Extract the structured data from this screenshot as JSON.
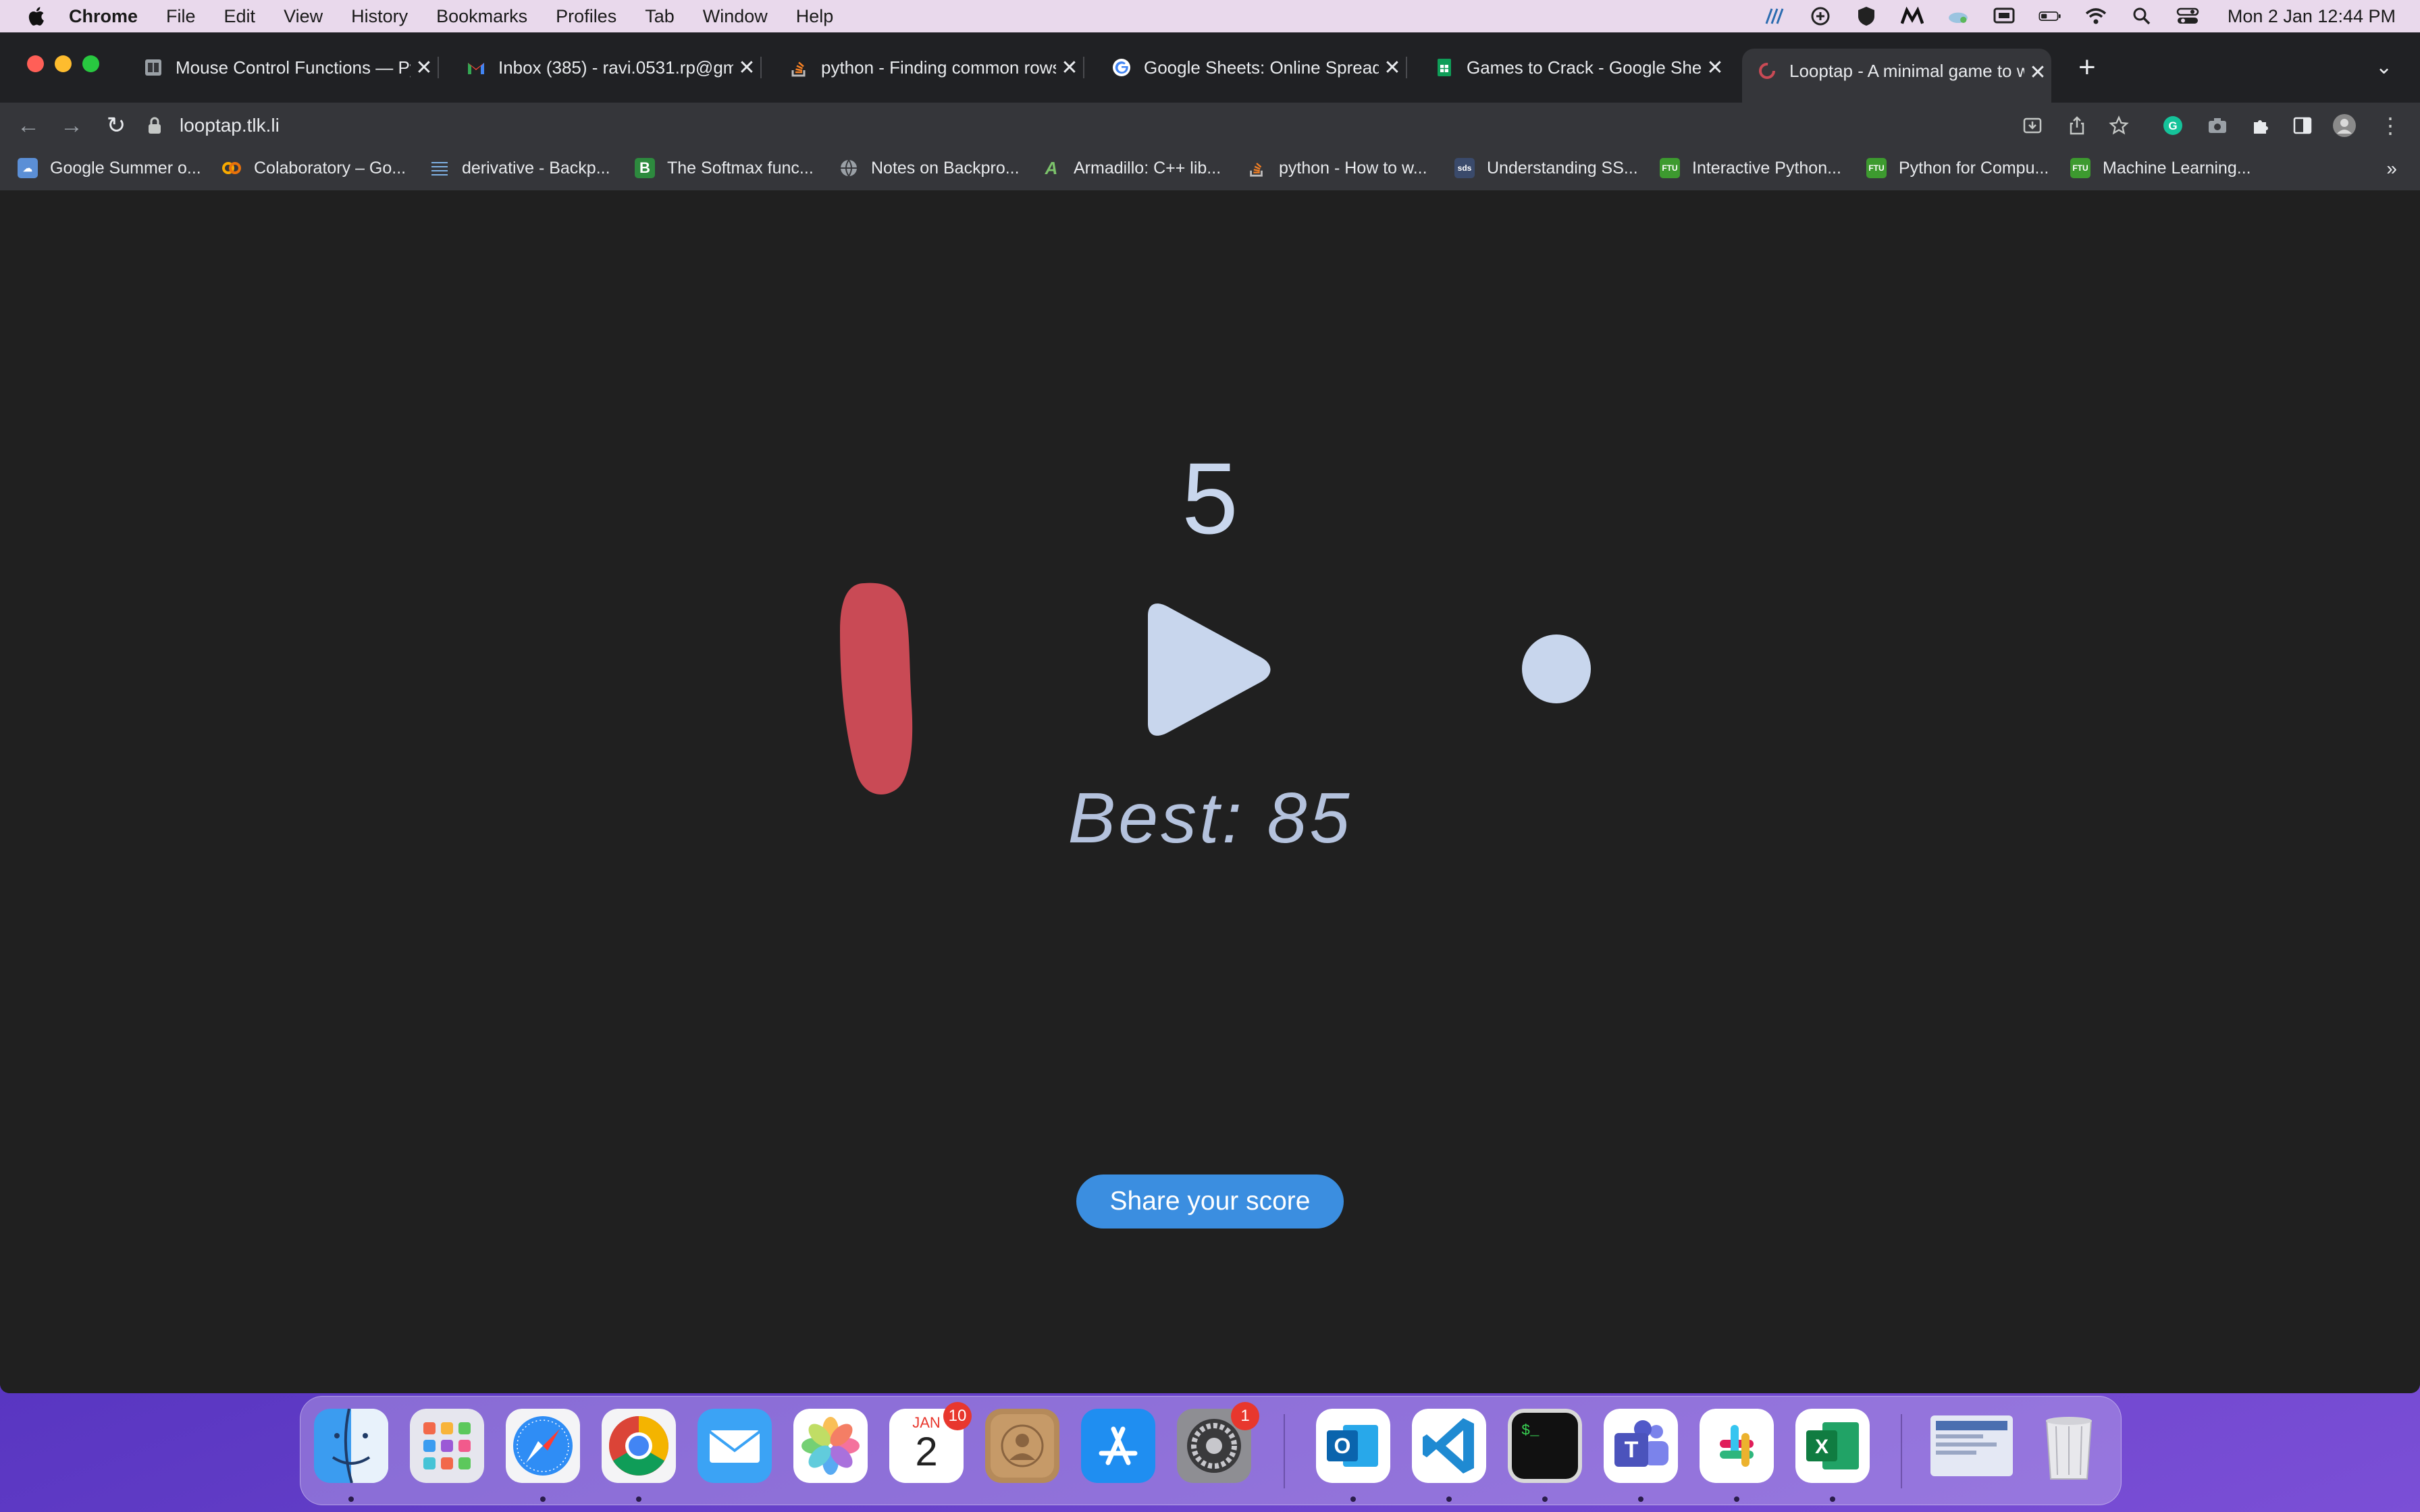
{
  "menubar": {
    "app_name": "Chrome",
    "items": [
      "File",
      "Edit",
      "View",
      "History",
      "Bookmarks",
      "Profiles",
      "Tab",
      "Window",
      "Help"
    ],
    "clock": "Mon 2 Jan  12:44 PM"
  },
  "tabs": [
    {
      "title": "Mouse Control Functions — Py",
      "favicon": "doc-icon"
    },
    {
      "title": "Inbox (385) - ravi.0531.rp@gm",
      "favicon": "gmail-icon"
    },
    {
      "title": "python - Finding common rows",
      "favicon": "stackoverflow-icon"
    },
    {
      "title": "Google Sheets: Online Spreads",
      "favicon": "google-icon"
    },
    {
      "title": "Games to Crack - Google Shee",
      "favicon": "sheets-icon"
    },
    {
      "title": "Looptap - A minimal game to w",
      "favicon": "looptap-icon",
      "active": true
    }
  ],
  "omnibox": {
    "url": "looptap.tlk.li"
  },
  "bookmarks": [
    {
      "label": "Google Summer o...",
      "icon": "cloud-icon"
    },
    {
      "label": "Colaboratory – Go...",
      "icon": "colab-icon"
    },
    {
      "label": "derivative - Backp...",
      "icon": "grid-icon"
    },
    {
      "label": "The Softmax func...",
      "icon": "b-icon"
    },
    {
      "label": "Notes on Backpro...",
      "icon": "globe-icon"
    },
    {
      "label": "Armadillo: C++ lib...",
      "icon": "armadillo-icon"
    },
    {
      "label": "python - How to w...",
      "icon": "stackoverflow-icon"
    },
    {
      "label": "Understanding SS...",
      "icon": "sds-icon"
    },
    {
      "label": "Interactive Python...",
      "icon": "ftu-icon"
    },
    {
      "label": "Python for Compu...",
      "icon": "ftu-icon"
    },
    {
      "label": "Machine Learning...",
      "icon": "ftu-icon"
    }
  ],
  "game": {
    "score": "5",
    "best": "Best: 85",
    "share_label": "Share your score"
  },
  "dock": {
    "apps": [
      "Finder",
      "Launchpad",
      "Safari",
      "Chrome",
      "Mail",
      "Photos",
      "Calendar",
      "Contacts",
      "App Store",
      "System Preferences",
      "Outlook",
      "VS Code",
      "Terminal",
      "Teams",
      "Slack",
      "Excel",
      "Downloads",
      "Trash"
    ],
    "calendar_month": "JAN",
    "calendar_day": "2",
    "calendar_badge": "10",
    "settings_badge": "1"
  },
  "colors": {
    "page_bg": "#202020",
    "score_color": "#c8d6ed",
    "paddle_color": "#c94a55",
    "share_button": "#3b8ee0"
  }
}
